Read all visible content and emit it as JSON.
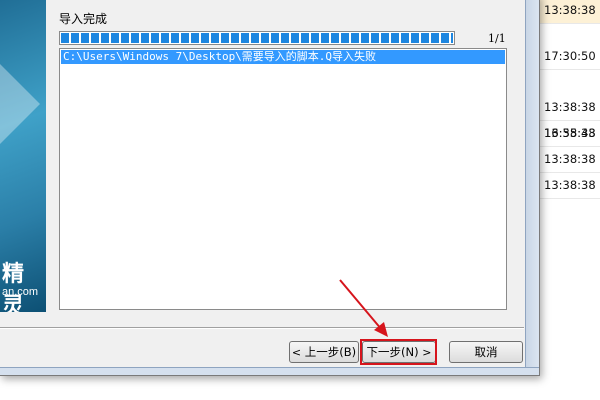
{
  "background_list": {
    "rows": [
      {
        "time": "13:38:38",
        "highlighted": true
      },
      {
        "time": "17:30:50",
        "highlighted": false
      },
      {
        "time": "13:38:38",
        "highlighted": false
      },
      {
        "time": "13:38:38",
        "highlighted": false
      },
      {
        "time": "16:55:43",
        "highlighted": false
      },
      {
        "time": "13:38:38",
        "highlighted": false
      },
      {
        "time": "13:38:38",
        "highlighted": false
      }
    ]
  },
  "dialog": {
    "section_title": "导入完成",
    "progress": {
      "fraction": 1.0,
      "count_text": "1/1"
    },
    "log_items": [
      "C:\\Users\\Windows 7\\Desktop\\需要导入的脚本.Q导入失败"
    ],
    "banner": {
      "brand_text": "精灵",
      "site_text": "an.com"
    },
    "buttons": {
      "back": {
        "label": "上一步(B)",
        "chev": "<"
      },
      "next": {
        "label": "下一步(N)",
        "chev": ">"
      },
      "cancel": {
        "label": "取消"
      }
    }
  },
  "colors": {
    "progress_fill": "#1d86e0",
    "selection": "#3399ff",
    "annotation": "#d6141c",
    "row_highlight": "#fdf1d6"
  },
  "icons": {
    "annotation": "red-arrow-icon"
  }
}
